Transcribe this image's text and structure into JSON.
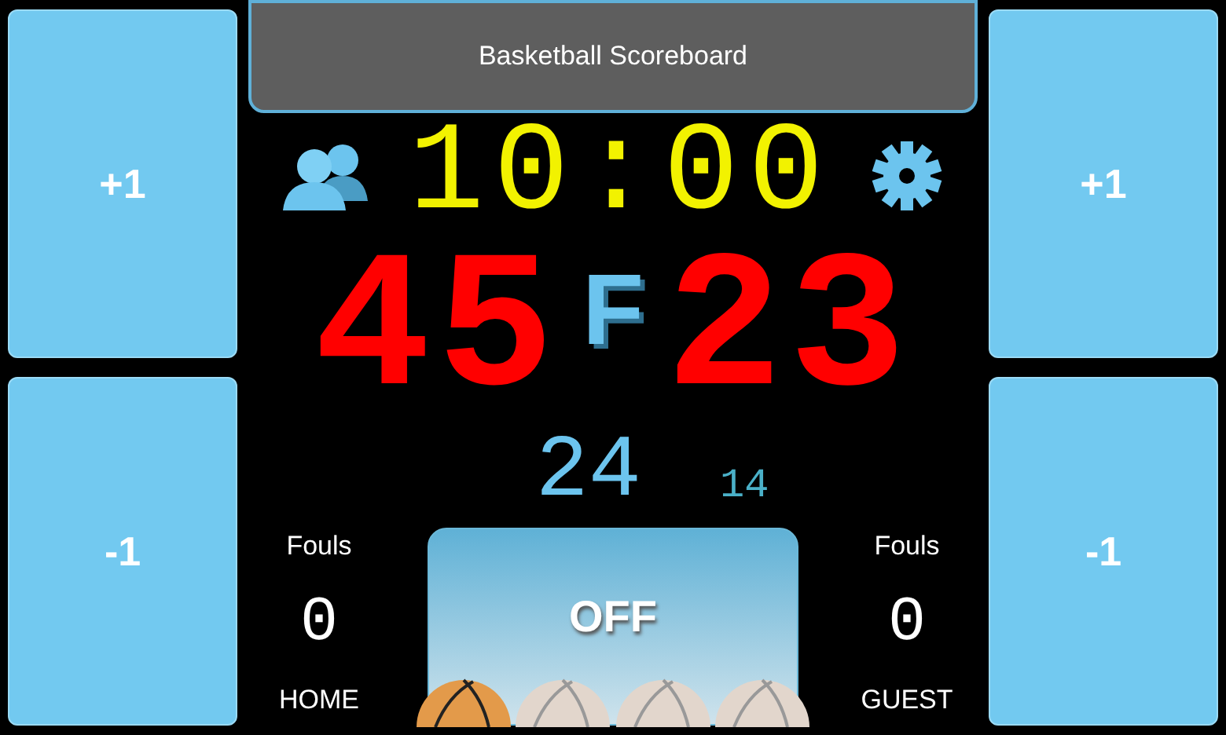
{
  "title": "Basketball Scoreboard",
  "side_buttons": {
    "home": [
      "+1",
      "-1"
    ],
    "guest": [
      "+1",
      "-1"
    ]
  },
  "clock": "10:00",
  "home_score": "45",
  "guest_score": "23",
  "indicator": "F",
  "shot_clock": "24",
  "small_counter": "14",
  "home": {
    "fouls_label": "Fouls",
    "fouls": "0",
    "name": "HOME"
  },
  "guest": {
    "fouls_label": "Fouls",
    "fouls": "0",
    "name": "GUEST"
  },
  "toggle": "OFF",
  "periods": [
    {
      "selected": true
    },
    {
      "selected": false
    },
    {
      "selected": false
    },
    {
      "selected": false
    }
  ]
}
